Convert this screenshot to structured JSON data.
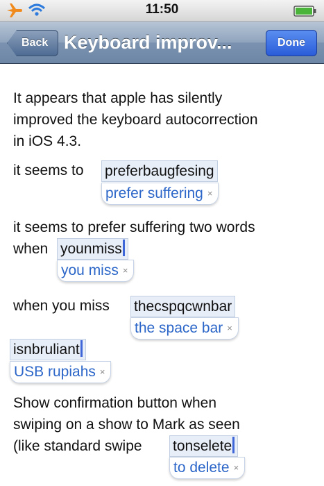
{
  "status_bar": {
    "time": "11:50",
    "icons": [
      "airplane-icon",
      "wifi-icon",
      "battery-icon"
    ]
  },
  "nav": {
    "back_label": "Back",
    "title": "Keyboard improv...",
    "done_label": "Done"
  },
  "content": {
    "para1": [
      "It appears that apple has silently",
      "improved the keyboard autocorrection",
      "in iOS 4.3."
    ],
    "para2_prefix": "it seems to",
    "typed1": "preferbaugfesing",
    "suggestion1": "prefer suffering",
    "para3_line1": "it seems to prefer suffering two words",
    "para3_prefix": "when",
    "typed2": "younmiss",
    "suggestion2": "you miss",
    "para4_prefix": "when you miss",
    "typed3": "thecspqcwnbar",
    "suggestion3": "the space bar",
    "typed4": "isnbruliant",
    "suggestion4": "USB rupiahs",
    "para5": [
      "Show confirmation button when",
      "swiping on a show to Mark as seen"
    ],
    "para5_prefix": "(like standard swipe",
    "typed5": "tonselete",
    "suggestion5": "to delete",
    "dismiss_glyph": "×"
  },
  "colors": {
    "accent_blue": "#2b66c8",
    "cursor": "#3f66d8",
    "navbar": "#7b93b0",
    "done_button": "#2a5cd9"
  }
}
